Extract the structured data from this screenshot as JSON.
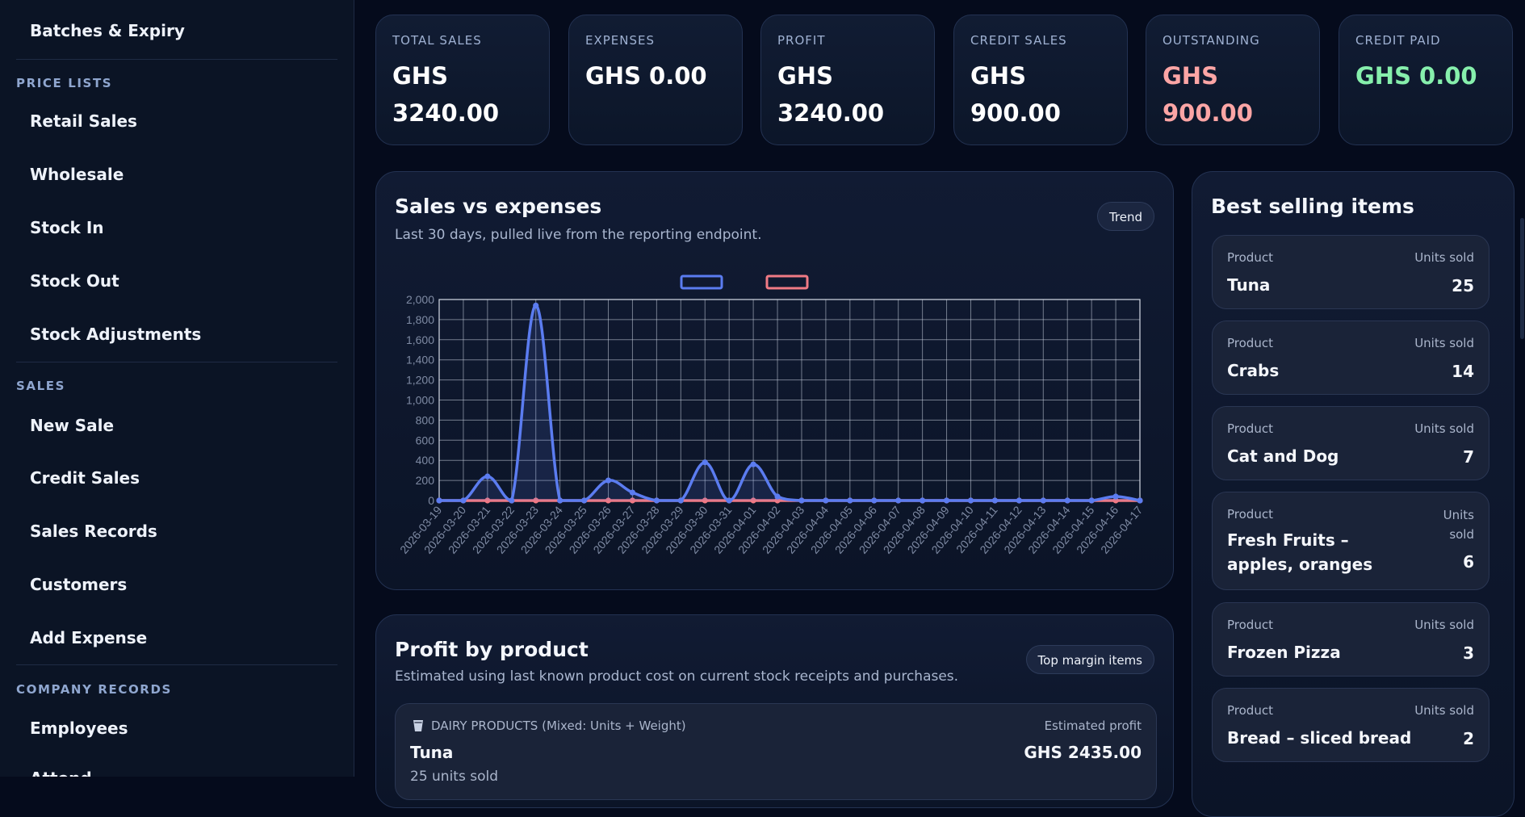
{
  "sidebar": {
    "items_top": [
      "Batches & Expiry"
    ],
    "sections": [
      {
        "title": "PRICE LISTS",
        "items": [
          "Retail Sales",
          "Wholesale",
          "Stock In",
          "Stock Out",
          "Stock Adjustments"
        ]
      },
      {
        "title": "SALES",
        "items": [
          "New Sale",
          "Credit Sales",
          "Sales Records",
          "Customers",
          "Add Expense"
        ]
      },
      {
        "title": "COMPANY RECORDS",
        "items": [
          "Employees",
          "Attend"
        ]
      }
    ]
  },
  "stats": [
    {
      "label": "TOTAL SALES",
      "value": "GHS 3240.00",
      "color": "#ffffff"
    },
    {
      "label": "EXPENSES",
      "value": "GHS 0.00",
      "color": "#ffffff"
    },
    {
      "label": "PROFIT",
      "value": "GHS 3240.00",
      "color": "#ffffff"
    },
    {
      "label": "CREDIT SALES",
      "value": "GHS 900.00",
      "color": "#ffffff"
    },
    {
      "label": "OUTSTANDING",
      "value": "GHS 900.00",
      "color": "#fca5a5"
    },
    {
      "label": "CREDIT PAID",
      "value": "GHS 0.00",
      "color": "#86efac"
    }
  ],
  "sales_panel": {
    "title": "Sales vs expenses",
    "subtitle": "Last 30 days, pulled live from the reporting endpoint.",
    "pill": "Trend"
  },
  "chart_data": {
    "type": "line",
    "x": [
      "2026-03-19",
      "2026-03-20",
      "2026-03-21",
      "2026-03-22",
      "2026-03-23",
      "2026-03-24",
      "2026-03-25",
      "2026-03-26",
      "2026-03-27",
      "2026-03-28",
      "2026-03-29",
      "2026-03-30",
      "2026-03-31",
      "2026-04-01",
      "2026-04-02",
      "2026-04-03",
      "2026-04-04",
      "2026-04-05",
      "2026-04-06",
      "2026-04-07",
      "2026-04-08",
      "2026-04-09",
      "2026-04-10",
      "2026-04-11",
      "2026-04-12",
      "2026-04-13",
      "2026-04-14",
      "2026-04-15",
      "2026-04-16",
      "2026-04-17"
    ],
    "series": [
      {
        "values": [
          0,
          0,
          240,
          0,
          1940,
          0,
          0,
          200,
          80,
          0,
          0,
          380,
          0,
          360,
          40,
          0,
          0,
          0,
          0,
          0,
          0,
          0,
          0,
          0,
          0,
          0,
          0,
          0,
          40,
          0
        ],
        "color": "#5b7cf0"
      },
      {
        "values": [
          0,
          0,
          0,
          0,
          0,
          0,
          0,
          0,
          0,
          0,
          0,
          0,
          0,
          0,
          0,
          0,
          0,
          0,
          0,
          0,
          0,
          0,
          0,
          0,
          0,
          0,
          0,
          0,
          0,
          0
        ],
        "color": "#f07a85"
      }
    ],
    "ylim": [
      0,
      2000
    ],
    "yticks": [
      "0",
      "200",
      "400",
      "600",
      "800",
      "1,000",
      "1,200",
      "1,400",
      "1,600",
      "1,800",
      "2,000"
    ],
    "grid": true,
    "legend": "top"
  },
  "best_panel": {
    "title": "Best selling items",
    "col_left": "Product",
    "col_right": "Units sold",
    "items": [
      {
        "name": "Tuna",
        "units": "25"
      },
      {
        "name": "Crabs",
        "units": "14"
      },
      {
        "name": "Cat and Dog",
        "units": "7"
      },
      {
        "name": "Fresh Fruits – apples, oranges",
        "units": "6"
      },
      {
        "name": "Frozen Pizza",
        "units": "3"
      },
      {
        "name": "Bread – sliced bread",
        "units": "2"
      }
    ]
  },
  "profit_panel": {
    "title": "Profit by product",
    "subtitle": "Estimated using last known product cost on current stock receipts and purchases.",
    "pill": "Top margin items",
    "card": {
      "category": "DAIRY PRODUCTS (Mixed: Units + Weight)",
      "category_icon": "cup-icon",
      "profit_label": "Estimated profit",
      "product": "Tuna",
      "profit": "GHS 2435.00",
      "units": "25 units sold"
    }
  }
}
